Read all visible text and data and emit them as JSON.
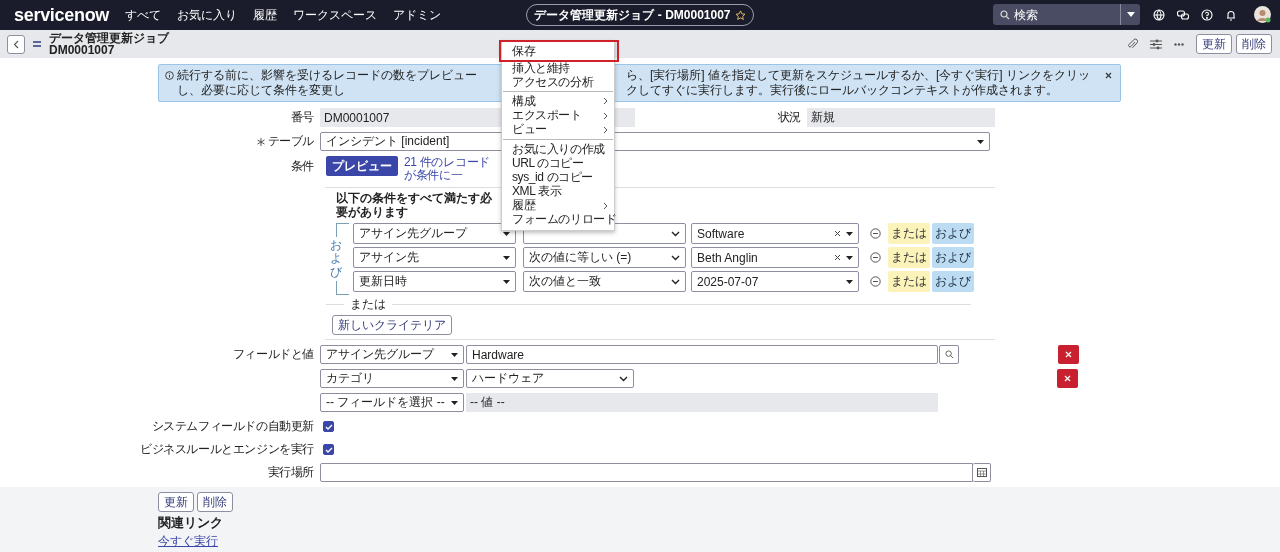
{
  "top_nav": {
    "logo": "servicenow",
    "items": [
      "すべて",
      "お気に入り",
      "履歴",
      "ワークスペース",
      "アドミン"
    ],
    "title": "データ管理更新ジョブ - DM0001007",
    "search": {
      "placeholder": "検索"
    }
  },
  "header": {
    "title": "データ管理更新ジョブ",
    "subtitle": "DM0001007",
    "buttons": [
      "更新",
      "削除"
    ]
  },
  "banner": {
    "text_before": "続行する前に、影響を受けるレコードの数をプレビューし、必要に応じて条件を変更し",
    "text_after": "ら、[実行場所] 値を指定して更新をスケジュールするか、[今すぐ実行] リンクをクリックしてすぐに実行します。実行後にロールバックコンテキストが作成されます。"
  },
  "fields": {
    "number": {
      "label": "番号",
      "value": "DM0001007"
    },
    "state": {
      "label": "状況",
      "value": "新規"
    },
    "table": {
      "label": "テーブル",
      "required": true,
      "value": "インシデント [incident]"
    }
  },
  "condition": {
    "label": "条件",
    "preview_button": "プレビュー",
    "match_link": "21 件のレコードが条件に一",
    "heading": "以下の条件をすべて満たす必要があります",
    "group_label": "および",
    "rows": [
      {
        "field": "アサイン先グループ",
        "value": "Software",
        "clearable": true,
        "or_button": "または",
        "and_button": "および"
      },
      {
        "field": "アサイン先",
        "operator": "次の値に等しい (=)",
        "value": "Beth Anglin",
        "clearable": true,
        "or_button": "または",
        "and_button": "および"
      },
      {
        "field": "更新日時",
        "operator": "次の値と一致",
        "value": "2025-07-07",
        "clearable": false,
        "or_button": "または",
        "and_button": "および"
      }
    ],
    "or_label": "または",
    "new_criteria_button": "新しいクライテリア"
  },
  "field_values": {
    "label": "フィールドと値",
    "rows": [
      {
        "kind": "reference",
        "field": "アサイン先グループ",
        "value": "Hardware",
        "removable": true
      },
      {
        "kind": "choice",
        "field": "カテゴリ",
        "value": "ハードウェア",
        "removable": true
      },
      {
        "kind": "empty",
        "field": "-- フィールドを選択 --",
        "value": "-- 値 --",
        "removable": false
      }
    ]
  },
  "options": [
    {
      "label": "システムフィールドの自動更新",
      "checked": true
    },
    {
      "label": "ビジネスルールとエンジンを実行",
      "checked": true
    }
  ],
  "run_at": {
    "label": "実行場所"
  },
  "footer": {
    "buttons": [
      "更新",
      "削除"
    ],
    "related_heading": "関連リンク",
    "links": [
      "今すぐ実行"
    ]
  },
  "context_menu": {
    "items": [
      {
        "kind": "item",
        "label": "保存",
        "selected": true,
        "submenu": false
      },
      {
        "kind": "item",
        "label": "挿入と維持",
        "selected": false,
        "submenu": false
      },
      {
        "kind": "item",
        "label": "アクセスの分析",
        "selected": false,
        "submenu": false
      },
      {
        "kind": "divider"
      },
      {
        "kind": "item",
        "label": "構成",
        "selected": false,
        "submenu": true
      },
      {
        "kind": "item",
        "label": "エクスポート",
        "selected": false,
        "submenu": true
      },
      {
        "kind": "item",
        "label": "ビュー",
        "selected": false,
        "submenu": true
      },
      {
        "kind": "divider"
      },
      {
        "kind": "item",
        "label": "お気に入りの作成",
        "selected": false,
        "submenu": false
      },
      {
        "kind": "item",
        "label": "URL のコピー",
        "selected": false,
        "submenu": false
      },
      {
        "kind": "item",
        "label": "sys_id のコピー",
        "selected": false,
        "submenu": false
      },
      {
        "kind": "item",
        "label": "XML 表示",
        "selected": false,
        "submenu": false
      },
      {
        "kind": "item",
        "label": "履歴",
        "selected": false,
        "submenu": true
      },
      {
        "kind": "item",
        "label": "フォームのリロード",
        "selected": false,
        "submenu": false
      }
    ]
  }
}
